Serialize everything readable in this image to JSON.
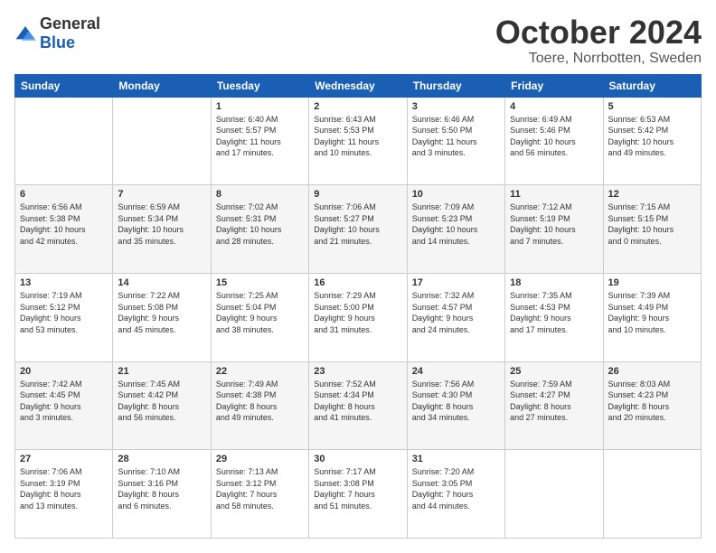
{
  "logo": {
    "general": "General",
    "blue": "Blue"
  },
  "header": {
    "month": "October 2024",
    "location": "Toere, Norrbotten, Sweden"
  },
  "weekdays": [
    "Sunday",
    "Monday",
    "Tuesday",
    "Wednesday",
    "Thursday",
    "Friday",
    "Saturday"
  ],
  "weeks": [
    [
      {
        "day": "",
        "info": ""
      },
      {
        "day": "",
        "info": ""
      },
      {
        "day": "1",
        "info": "Sunrise: 6:40 AM\nSunset: 5:57 PM\nDaylight: 11 hours\nand 17 minutes."
      },
      {
        "day": "2",
        "info": "Sunrise: 6:43 AM\nSunset: 5:53 PM\nDaylight: 11 hours\nand 10 minutes."
      },
      {
        "day": "3",
        "info": "Sunrise: 6:46 AM\nSunset: 5:50 PM\nDaylight: 11 hours\nand 3 minutes."
      },
      {
        "day": "4",
        "info": "Sunrise: 6:49 AM\nSunset: 5:46 PM\nDaylight: 10 hours\nand 56 minutes."
      },
      {
        "day": "5",
        "info": "Sunrise: 6:53 AM\nSunset: 5:42 PM\nDaylight: 10 hours\nand 49 minutes."
      }
    ],
    [
      {
        "day": "6",
        "info": "Sunrise: 6:56 AM\nSunset: 5:38 PM\nDaylight: 10 hours\nand 42 minutes."
      },
      {
        "day": "7",
        "info": "Sunrise: 6:59 AM\nSunset: 5:34 PM\nDaylight: 10 hours\nand 35 minutes."
      },
      {
        "day": "8",
        "info": "Sunrise: 7:02 AM\nSunset: 5:31 PM\nDaylight: 10 hours\nand 28 minutes."
      },
      {
        "day": "9",
        "info": "Sunrise: 7:06 AM\nSunset: 5:27 PM\nDaylight: 10 hours\nand 21 minutes."
      },
      {
        "day": "10",
        "info": "Sunrise: 7:09 AM\nSunset: 5:23 PM\nDaylight: 10 hours\nand 14 minutes."
      },
      {
        "day": "11",
        "info": "Sunrise: 7:12 AM\nSunset: 5:19 PM\nDaylight: 10 hours\nand 7 minutes."
      },
      {
        "day": "12",
        "info": "Sunrise: 7:15 AM\nSunset: 5:15 PM\nDaylight: 10 hours\nand 0 minutes."
      }
    ],
    [
      {
        "day": "13",
        "info": "Sunrise: 7:19 AM\nSunset: 5:12 PM\nDaylight: 9 hours\nand 53 minutes."
      },
      {
        "day": "14",
        "info": "Sunrise: 7:22 AM\nSunset: 5:08 PM\nDaylight: 9 hours\nand 45 minutes."
      },
      {
        "day": "15",
        "info": "Sunrise: 7:25 AM\nSunset: 5:04 PM\nDaylight: 9 hours\nand 38 minutes."
      },
      {
        "day": "16",
        "info": "Sunrise: 7:29 AM\nSunset: 5:00 PM\nDaylight: 9 hours\nand 31 minutes."
      },
      {
        "day": "17",
        "info": "Sunrise: 7:32 AM\nSunset: 4:57 PM\nDaylight: 9 hours\nand 24 minutes."
      },
      {
        "day": "18",
        "info": "Sunrise: 7:35 AM\nSunset: 4:53 PM\nDaylight: 9 hours\nand 17 minutes."
      },
      {
        "day": "19",
        "info": "Sunrise: 7:39 AM\nSunset: 4:49 PM\nDaylight: 9 hours\nand 10 minutes."
      }
    ],
    [
      {
        "day": "20",
        "info": "Sunrise: 7:42 AM\nSunset: 4:45 PM\nDaylight: 9 hours\nand 3 minutes."
      },
      {
        "day": "21",
        "info": "Sunrise: 7:45 AM\nSunset: 4:42 PM\nDaylight: 8 hours\nand 56 minutes."
      },
      {
        "day": "22",
        "info": "Sunrise: 7:49 AM\nSunset: 4:38 PM\nDaylight: 8 hours\nand 49 minutes."
      },
      {
        "day": "23",
        "info": "Sunrise: 7:52 AM\nSunset: 4:34 PM\nDaylight: 8 hours\nand 41 minutes."
      },
      {
        "day": "24",
        "info": "Sunrise: 7:56 AM\nSunset: 4:30 PM\nDaylight: 8 hours\nand 34 minutes."
      },
      {
        "day": "25",
        "info": "Sunrise: 7:59 AM\nSunset: 4:27 PM\nDaylight: 8 hours\nand 27 minutes."
      },
      {
        "day": "26",
        "info": "Sunrise: 8:03 AM\nSunset: 4:23 PM\nDaylight: 8 hours\nand 20 minutes."
      }
    ],
    [
      {
        "day": "27",
        "info": "Sunrise: 7:06 AM\nSunset: 3:19 PM\nDaylight: 8 hours\nand 13 minutes."
      },
      {
        "day": "28",
        "info": "Sunrise: 7:10 AM\nSunset: 3:16 PM\nDaylight: 8 hours\nand 6 minutes."
      },
      {
        "day": "29",
        "info": "Sunrise: 7:13 AM\nSunset: 3:12 PM\nDaylight: 7 hours\nand 58 minutes."
      },
      {
        "day": "30",
        "info": "Sunrise: 7:17 AM\nSunset: 3:08 PM\nDaylight: 7 hours\nand 51 minutes."
      },
      {
        "day": "31",
        "info": "Sunrise: 7:20 AM\nSunset: 3:05 PM\nDaylight: 7 hours\nand 44 minutes."
      },
      {
        "day": "",
        "info": ""
      },
      {
        "day": "",
        "info": ""
      }
    ]
  ]
}
